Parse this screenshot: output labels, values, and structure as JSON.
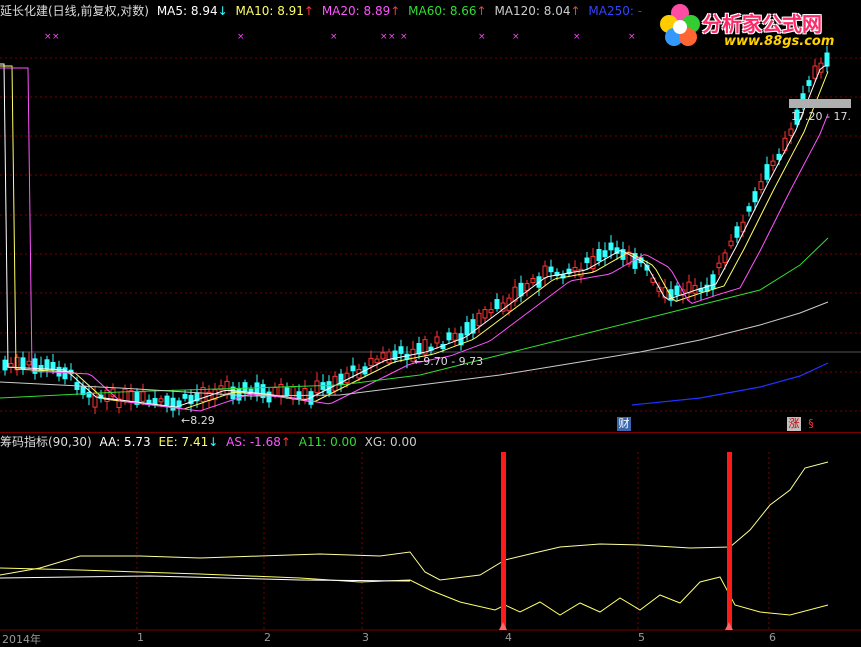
{
  "colors": {
    "ma5": "#ffffff",
    "ma10": "#ffff66",
    "ma20": "#ff55ff",
    "ma60": "#33dd33",
    "ma120": "#cccccc",
    "ma250": "#2233ff",
    "up": "#ff3333",
    "down": "#33ffff",
    "arrow_up": "#ff3333",
    "arrow_down": "#33ffff",
    "grid": "#7a0000",
    "bar": "#ff1a1a"
  },
  "header": {
    "title": "延长化建(日线,前复权,对数)",
    "ma5": "MA5: 8.94",
    "ma5_arrow": "↓",
    "ma10": "MA10: 8.91",
    "ma10_arrow": "↑",
    "ma20": "MA20: 8.89",
    "ma20_arrow": "↑",
    "ma60": "MA60: 8.66",
    "ma60_arrow": "↑",
    "ma120": "MA120: 8.04",
    "ma120_arrow": "↑",
    "ma250": "MA250: -"
  },
  "logo": {
    "name": "分析家公式网",
    "url": "www.88gs.com",
    "icon": "flower-logo-icon"
  },
  "price_panel": {
    "low_marker": "8.29",
    "range_label_mid": "9.70 - 9.73",
    "range_label_top": "17.20 - 17.",
    "badge_cai": "财",
    "badge_zhang": "涨",
    "badge_s": "§",
    "x_marker": "×"
  },
  "indicator": {
    "name": "筹码指标(90,30)",
    "aa": "AA: 5.73",
    "ee": "EE: 7.41",
    "ee_arrow": "↓",
    "as": "AS: -1.68",
    "as_arrow": "↑",
    "a11": "A11: 0.00",
    "xg": "XG: 0.00"
  },
  "xaxis": {
    "labels": [
      "2014年",
      "1",
      "2",
      "3",
      "4",
      "5",
      "6"
    ]
  }
}
